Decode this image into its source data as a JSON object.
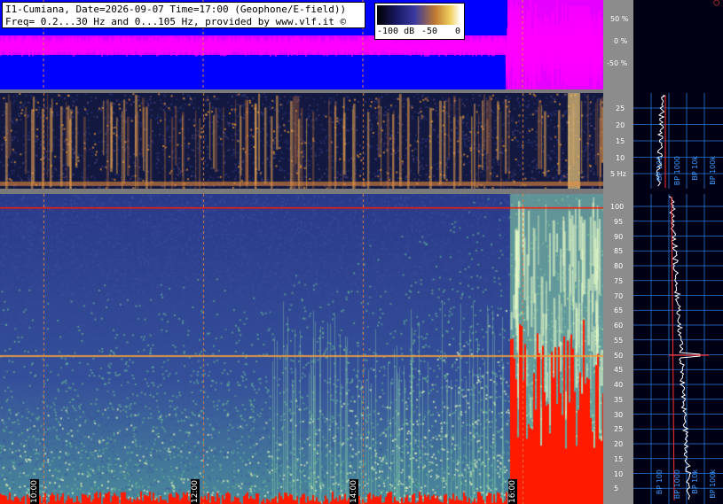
{
  "title": {
    "line1": "I1-Cumiana, Date=2026-09-07 Time=17:00 (Geophone/E-field))",
    "line2": "Freq= 0.2...30 Hz and 0...105 Hz, provided by www.vlf.it ©"
  },
  "legend": {
    "min": "-100 dB",
    "mid": "-50",
    "max": "0"
  },
  "wave_axis": [
    "50 %",
    "0 %",
    "-50 %"
  ],
  "low_freq_axis": [
    "25",
    "20",
    "15",
    "10",
    "5 Hz"
  ],
  "high_freq_axis": [
    "100",
    "95",
    "90",
    "85",
    "80",
    "75",
    "70",
    "65",
    "60",
    "55",
    "50",
    "45",
    "40",
    "35",
    "30",
    "25",
    "20",
    "15",
    "10",
    "5"
  ],
  "time_labels": [
    "10:00",
    "12:00",
    "14:00",
    "16:00"
  ],
  "bp_labels_top": [
    "BP 100",
    "BP 1000",
    "BP 10k",
    "BP 100k"
  ],
  "bp_labels_bottom": [
    "BP 100",
    "BP 1000",
    "BP 10k",
    "BP 100k"
  ],
  "colors": {
    "wave_bg": "#0000ff",
    "wave_signal": "#ff00ff",
    "spec_low": "#2b3b8e",
    "spec_high": "#e8f0c0",
    "spec_hot": "#ff1a00",
    "grid_line": "#e08040",
    "axis_bg": "#8c8c8c",
    "side_grid": "#2a7ad8"
  }
}
